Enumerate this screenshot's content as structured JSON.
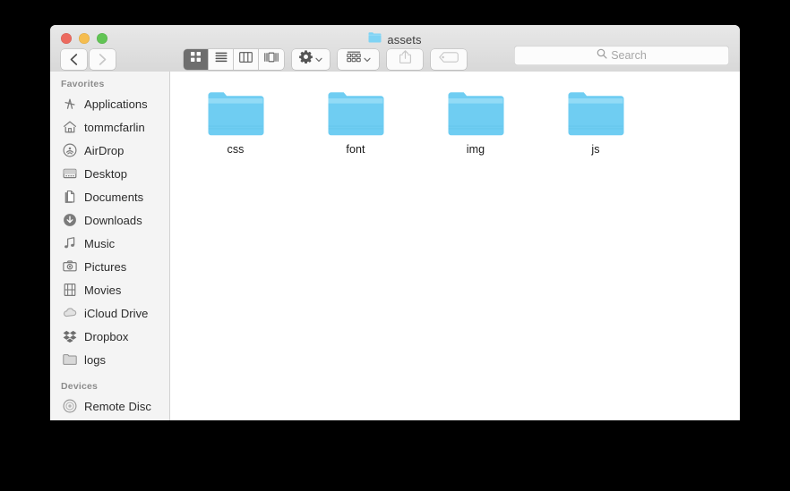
{
  "window": {
    "title": "assets",
    "title_icon": "folder-icon",
    "traffic_lights": [
      {
        "name": "close-button",
        "color": "#ec6a5f"
      },
      {
        "name": "minimize-button",
        "color": "#f5bd4f"
      },
      {
        "name": "maximize-button",
        "color": "#61c454"
      }
    ]
  },
  "toolbar": {
    "back_icon": "chevron-left-icon",
    "forward_icon": "chevron-right-icon",
    "back_enabled": true,
    "forward_enabled": false,
    "view_modes": [
      {
        "name": "icon-view",
        "icon": "grid-icon",
        "active": true
      },
      {
        "name": "list-view",
        "icon": "list-icon",
        "active": false
      },
      {
        "name": "column-view",
        "icon": "columns-icon",
        "active": false
      },
      {
        "name": "gallery-view",
        "icon": "gallery-icon",
        "active": false
      }
    ],
    "action_button": {
      "name": "action-menu",
      "icon": "gear-icon",
      "chevron": "chevron-down-icon"
    },
    "arrange_button": {
      "name": "arrange-menu",
      "icon": "arrange-icon",
      "chevron": "chevron-down-icon"
    },
    "share_button": {
      "name": "share-button",
      "icon": "share-icon",
      "enabled": false
    },
    "tag_button": {
      "name": "tag-button",
      "icon": "tag-icon",
      "enabled": false
    }
  },
  "search": {
    "icon": "search-icon",
    "placeholder": "Search",
    "value": ""
  },
  "sidebar": {
    "sections": [
      {
        "header": "Favorites",
        "items": [
          {
            "label": "Applications",
            "icon": "applications-icon"
          },
          {
            "label": "tommcfarlin",
            "icon": "home-icon"
          },
          {
            "label": "AirDrop",
            "icon": "airdrop-icon"
          },
          {
            "label": "Desktop",
            "icon": "desktop-icon"
          },
          {
            "label": "Documents",
            "icon": "documents-icon"
          },
          {
            "label": "Downloads",
            "icon": "downloads-icon"
          },
          {
            "label": "Music",
            "icon": "music-icon"
          },
          {
            "label": "Pictures",
            "icon": "pictures-icon"
          },
          {
            "label": "Movies",
            "icon": "movies-icon"
          },
          {
            "label": "iCloud Drive",
            "icon": "icloud-icon"
          },
          {
            "label": "Dropbox",
            "icon": "dropbox-icon"
          },
          {
            "label": "logs",
            "icon": "folder-icon"
          }
        ]
      },
      {
        "header": "Devices",
        "items": [
          {
            "label": "Remote Disc",
            "icon": "disc-icon"
          }
        ]
      }
    ]
  },
  "content": {
    "items": [
      {
        "label": "css",
        "icon": "folder-icon",
        "type": "folder"
      },
      {
        "label": "font",
        "icon": "folder-icon",
        "type": "folder"
      },
      {
        "label": "img",
        "icon": "folder-icon",
        "type": "folder"
      },
      {
        "label": "js",
        "icon": "folder-icon",
        "type": "folder"
      }
    ]
  },
  "colors": {
    "folder_blue": "#70cdf2",
    "folder_blue_light": "#8fd9f5",
    "sidebar_bg": "#f4f4f4",
    "titlebar_top": "#e8e8e8",
    "titlebar_bottom": "#d8d8d8",
    "active_segment": "#6e6e6e",
    "page_bg": "#000000"
  }
}
